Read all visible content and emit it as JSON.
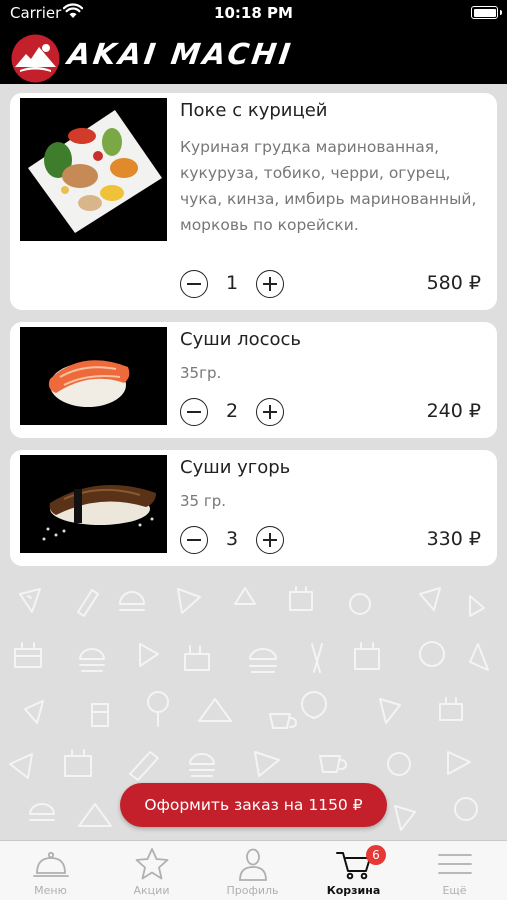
{
  "status_bar": {
    "carrier": "Carrier",
    "time": "10:18 PM"
  },
  "header": {
    "logo_text": "AKAI MACHI"
  },
  "cart_items": [
    {
      "name": "Поке с курицей",
      "description": "Куриная грудка маринованная, кукуруза, тобико, черри, огурец, чука, кинза, имбирь маринованный, морковь по корейски.",
      "quantity": "1",
      "price": "580 ₽"
    },
    {
      "name": "Суши лосось",
      "weight": "35гр.",
      "quantity": "2",
      "price": "240 ₽"
    },
    {
      "name": "Суши угорь",
      "weight": "35 гр.",
      "quantity": "3",
      "price": "330 ₽"
    }
  ],
  "order_button": {
    "label": "Оформить заказ на 1150 ₽"
  },
  "tab_bar": {
    "items": [
      {
        "label": "Меню",
        "icon": "cloche-icon"
      },
      {
        "label": "Акции",
        "icon": "star-icon"
      },
      {
        "label": "Профиль",
        "icon": "person-icon"
      },
      {
        "label": "Корзина",
        "icon": "cart-icon",
        "badge": "6",
        "active": true
      },
      {
        "label": "Ещё",
        "icon": "menu-icon"
      }
    ]
  },
  "colors": {
    "accent": "#c3202b",
    "badge": "#e53935",
    "header_bg": "#000000",
    "content_bg": "#dedede"
  }
}
